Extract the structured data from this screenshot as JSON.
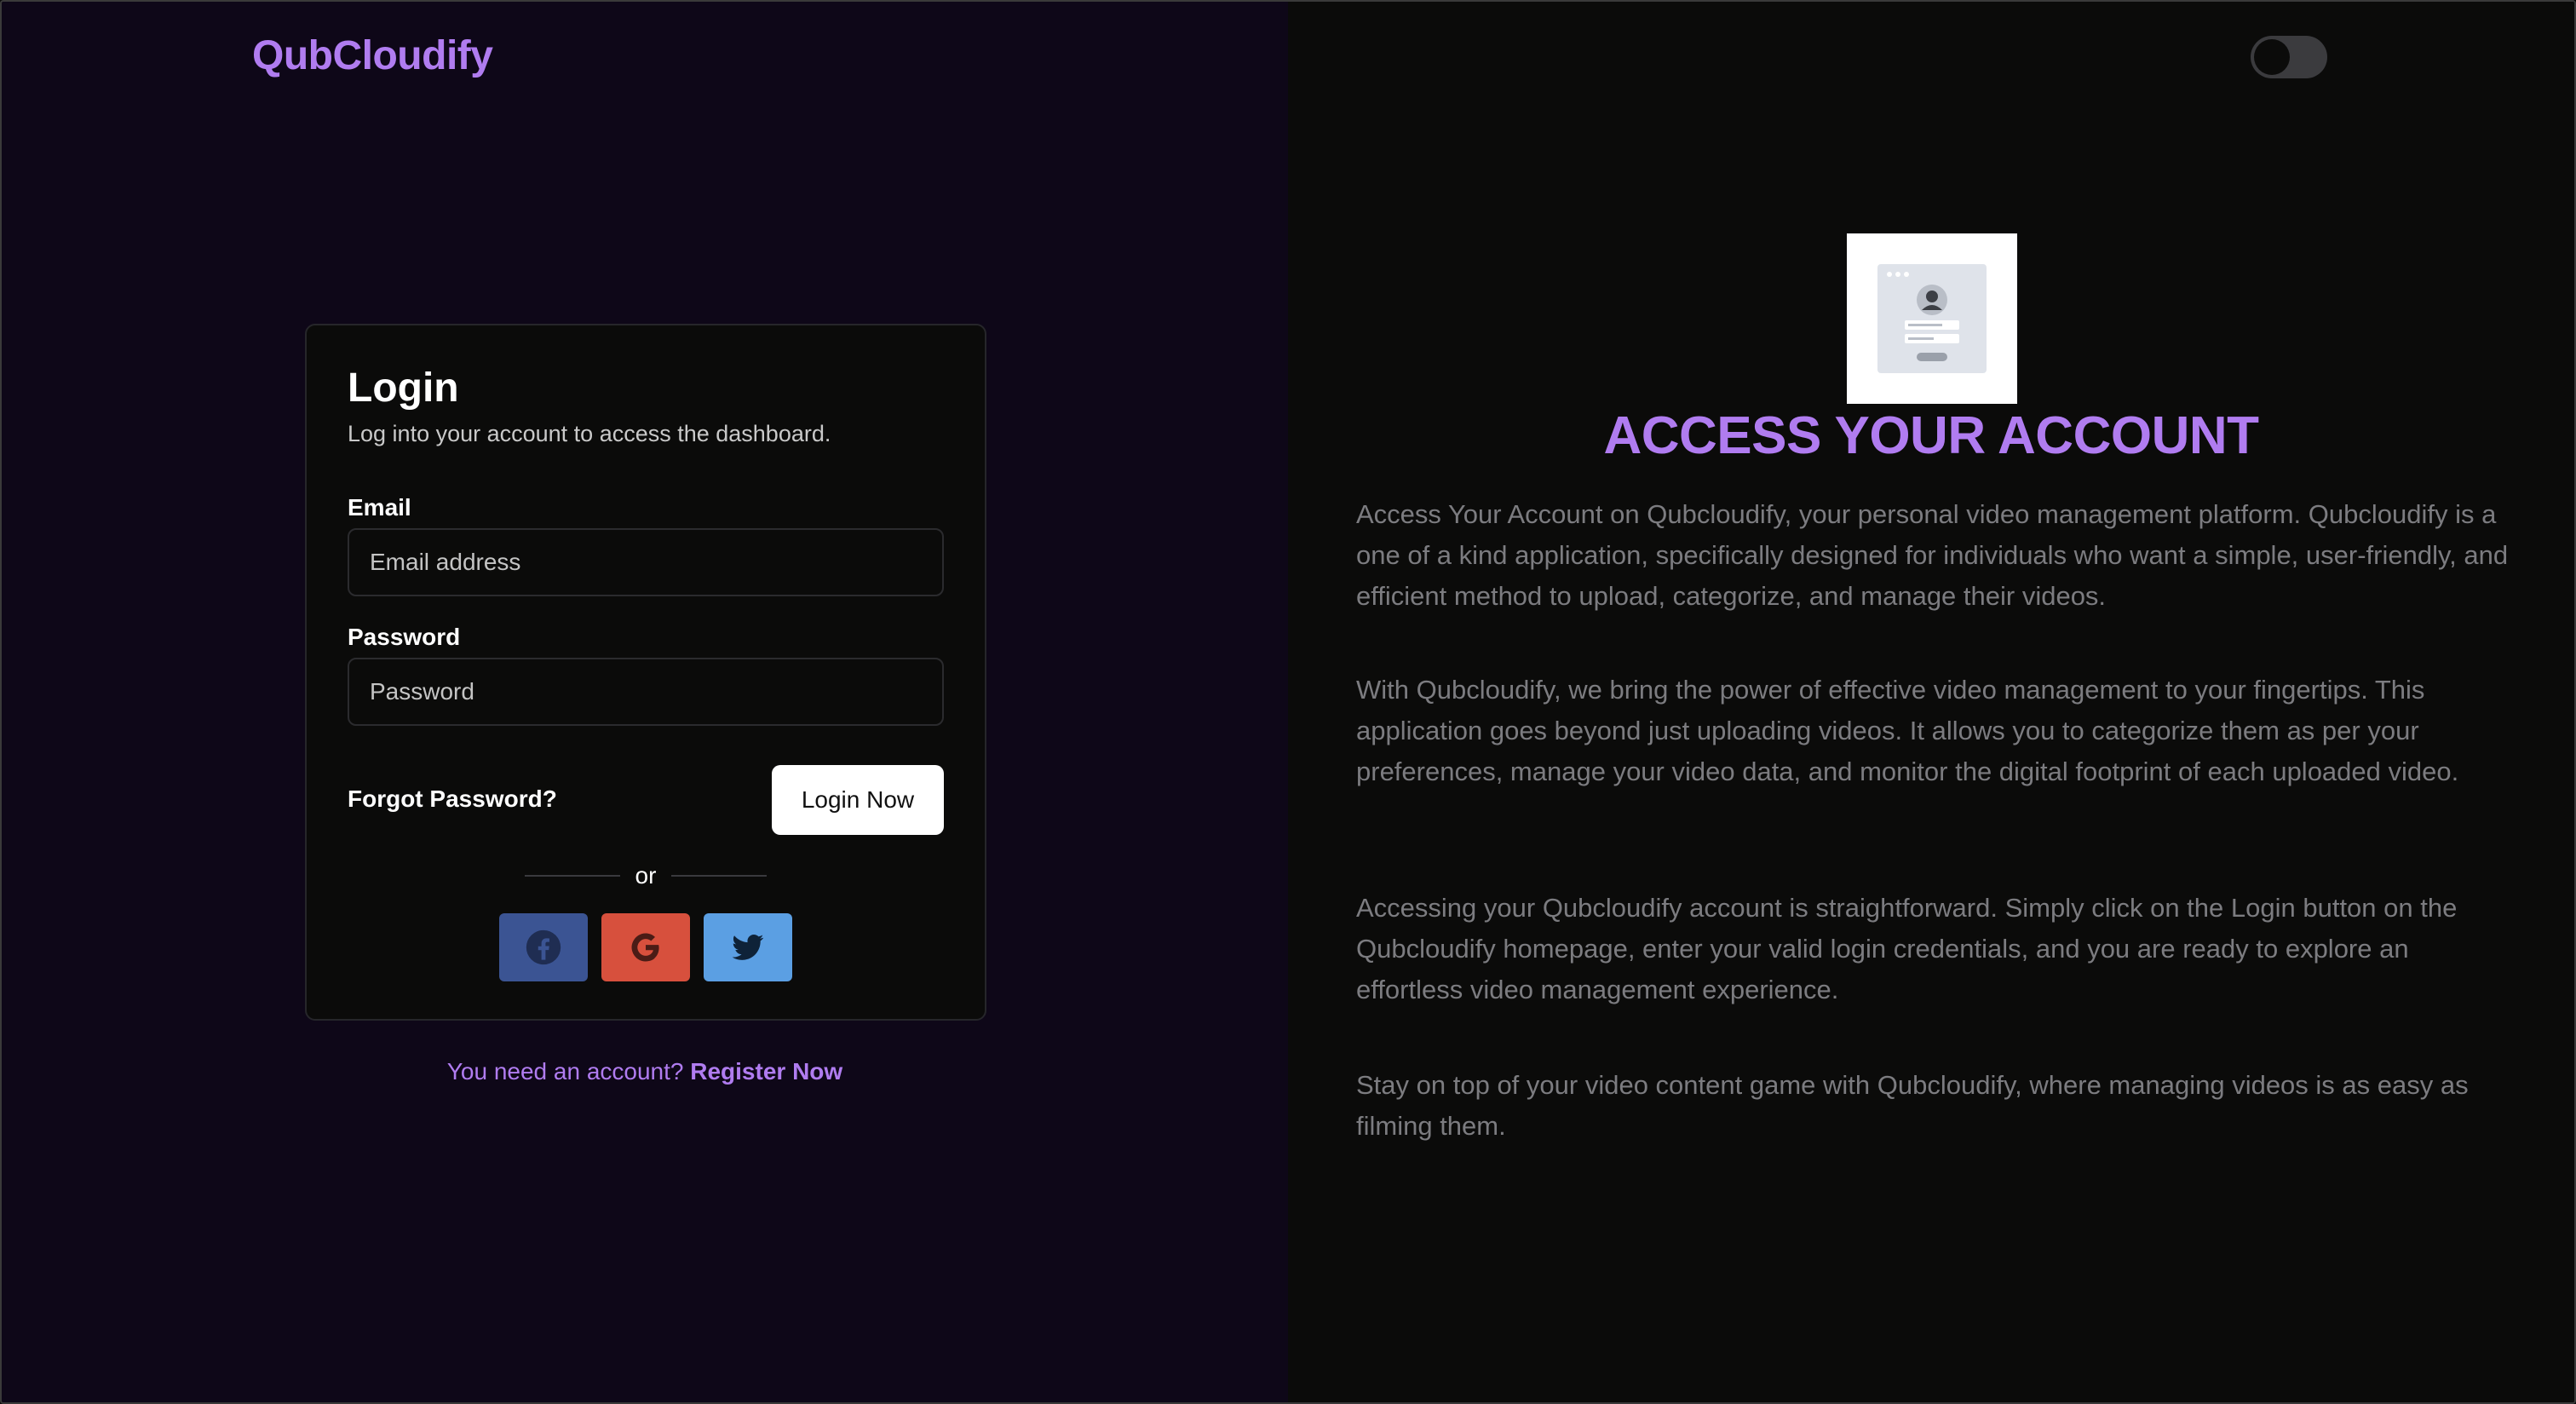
{
  "brand": {
    "name": "QubCloudify"
  },
  "login_card": {
    "title": "Login",
    "subtitle": "Log into your account to access the dashboard.",
    "email": {
      "label": "Email",
      "placeholder": "Email address",
      "value": ""
    },
    "password": {
      "label": "Password",
      "placeholder": "Password",
      "value": ""
    },
    "forgot_label": "Forgot Password?",
    "submit_label": "Login Now",
    "divider_text": "or",
    "social": [
      {
        "name": "facebook",
        "icon": "facebook-icon",
        "color": "#3b5493"
      },
      {
        "name": "google",
        "icon": "google-icon",
        "color": "#d7503d"
      },
      {
        "name": "twitter",
        "icon": "twitter-icon",
        "color": "#5b9fe3"
      }
    ]
  },
  "register": {
    "prompt": "You need an account?",
    "link_label": "Register Now"
  },
  "theme_toggle": {
    "state": "off"
  },
  "info": {
    "title": "ACCESS YOUR ACCOUNT",
    "paragraphs": [
      "Access Your Account on Qubcloudify, your personal video management platform. Qubcloudify is a one of a kind application, specifically designed for individuals who want a simple, user-friendly, and efficient method to upload, categorize, and manage their videos.",
      "With Qubcloudify, we bring the power of effective video management to your fingertips. This application goes beyond just uploading videos. It allows you to categorize them as per your preferences, manage your video data, and monitor the digital footprint of each uploaded video.",
      "Accessing your Qubcloudify account is straightforward. Simply click on the Login button on the Qubcloudify homepage, enter your valid login credentials, and you are ready to explore an effortless video management experience.",
      "Stay on top of your video content game with Qubcloudify, where managing videos is as easy as filming them."
    ]
  },
  "colors": {
    "accent": "#b07cf0",
    "left_background": "#0e0718",
    "right_background": "#0b0b0a",
    "paragraph_text": "#7c7c80"
  }
}
